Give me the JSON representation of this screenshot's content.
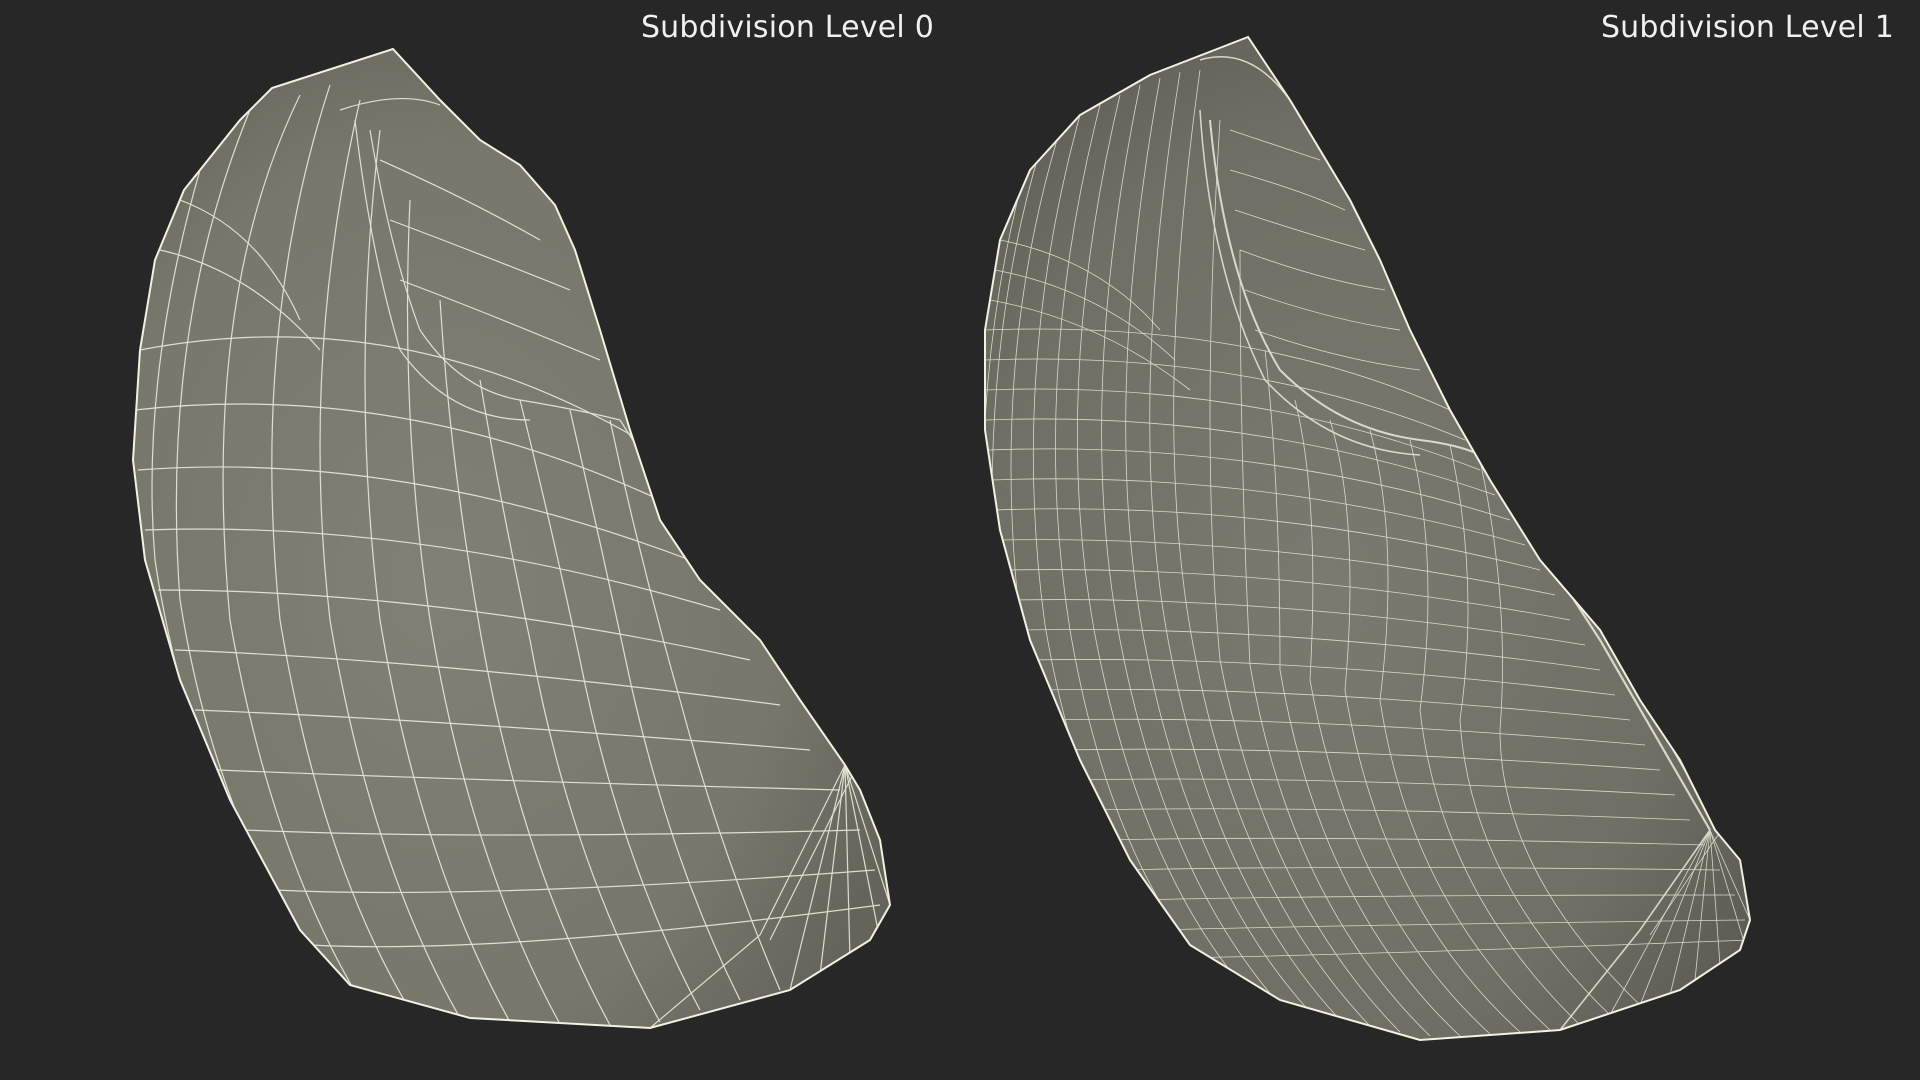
{
  "viewport": {
    "background_color": "#272727",
    "wire_color": "#f2f1e2",
    "surface_color": "#7b7b70",
    "surface_shadow_color": "#5c5c54"
  },
  "labels": {
    "left": "Subdivision Level 0",
    "right": "Subdivision Level 1"
  }
}
